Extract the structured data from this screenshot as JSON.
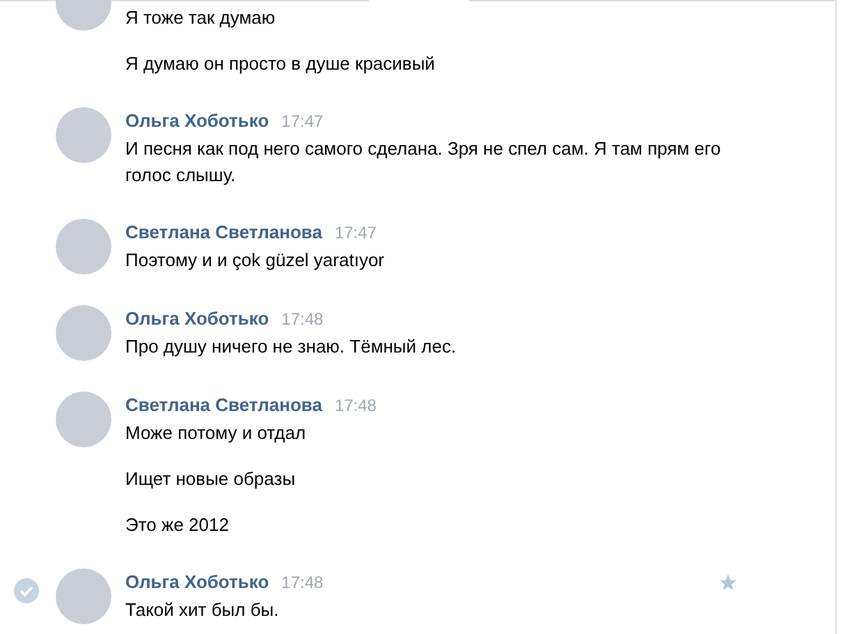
{
  "groups": [
    {
      "hovered": false,
      "messages": [
        "Я тоже так думаю",
        "Я думаю он просто в душе красивый"
      ]
    },
    {
      "author": "Ольга Хоботько",
      "time": "17:47",
      "hovered": false,
      "messages": [
        "И песня как под него самого сделана. Зря не спел сам. Я там прям его голос слышу."
      ]
    },
    {
      "author": "Светлана Светланова",
      "time": "17:47",
      "hovered": false,
      "messages": [
        "Поэтому и и çok güzel yaratıyor"
      ]
    },
    {
      "author": "Ольга Хоботько",
      "time": "17:48",
      "hovered": false,
      "messages": [
        "Про душу ничего не знаю. Тёмный лес."
      ]
    },
    {
      "author": "Светлана Светланова",
      "time": "17:48",
      "hovered": false,
      "messages": [
        "Може потому и отдал",
        "Ищет новые образы",
        "Это же 2012"
      ]
    },
    {
      "author": "Ольга Хоботько",
      "time": "17:48",
      "hovered": true,
      "messages": [
        "Такой хит был бы."
      ]
    }
  ]
}
